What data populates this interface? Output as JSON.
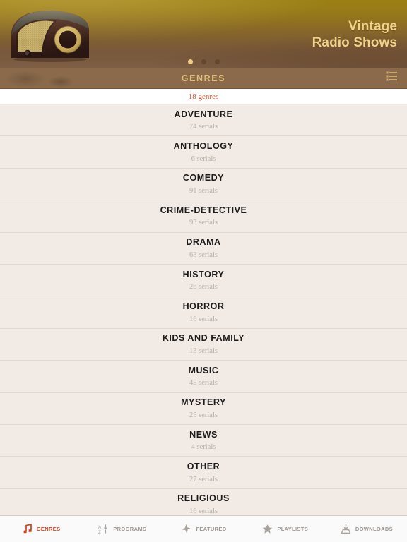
{
  "header": {
    "title_line1": "Vintage",
    "title_line2": "Radio Shows",
    "artwork_name": "vintage-radio-illustration",
    "pager": {
      "total": 3,
      "active_index": 0
    }
  },
  "section_bar": {
    "title": "GENRES",
    "sort_icon": "sort-list-icon"
  },
  "count_strip": {
    "text": "18 genres"
  },
  "genres": [
    {
      "name": "ADVENTURE",
      "count": "74 serials"
    },
    {
      "name": "ANTHOLOGY",
      "count": "6 serials"
    },
    {
      "name": "COMEDY",
      "count": "91 serials"
    },
    {
      "name": "CRIME-DETECTIVE",
      "count": "93 serials"
    },
    {
      "name": "DRAMA",
      "count": "63 serials"
    },
    {
      "name": "HISTORY",
      "count": "26 serials"
    },
    {
      "name": "HORROR",
      "count": "16 serials"
    },
    {
      "name": "KIDS AND FAMILY",
      "count": "13 serials"
    },
    {
      "name": "MUSIC",
      "count": "45 serials"
    },
    {
      "name": "MYSTERY",
      "count": "25 serials"
    },
    {
      "name": "NEWS",
      "count": "4 serials"
    },
    {
      "name": "OTHER",
      "count": "27 serials"
    },
    {
      "name": "RELIGIOUS",
      "count": "16 serials"
    }
  ],
  "tabbar": {
    "items": [
      {
        "label": "GENRES",
        "icon": "music-note-icon",
        "active": true
      },
      {
        "label": "PROGRAMS",
        "icon": "sort-az-icon",
        "active": false
      },
      {
        "label": "FEATURED",
        "icon": "sparkle-icon",
        "active": false
      },
      {
        "label": "PLAYLISTS",
        "icon": "star-icon",
        "active": false
      },
      {
        "label": "DOWNLOADS",
        "icon": "download-tray-icon",
        "active": false
      }
    ]
  },
  "colors": {
    "accent": "#d2401c",
    "count_text": "#d94f27",
    "hero_title": "#f0d28a",
    "section_title": "#e0bd79",
    "section_bar_bg": "#8a6a4b",
    "list_bg": "#f1eae5"
  }
}
